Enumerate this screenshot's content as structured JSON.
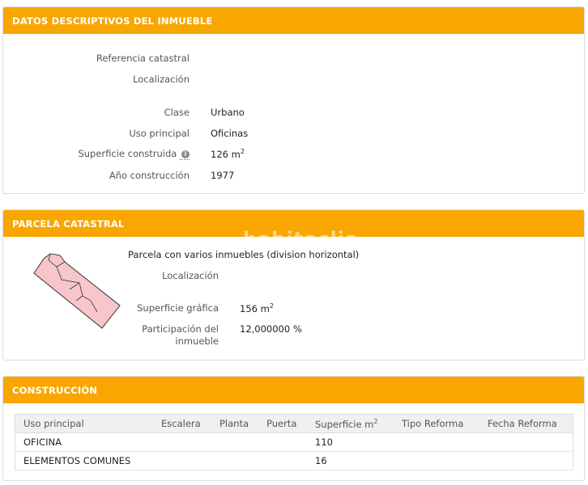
{
  "datos": {
    "title": "DATOS DESCRIPTIVOS DEL INMUEBLE",
    "rows": [
      {
        "label": "Referencia catastral",
        "value": ""
      },
      {
        "label": "Localización",
        "value": ""
      },
      {
        "label": "Clase",
        "value": "Urbano"
      },
      {
        "label": "Uso principal",
        "value": "Oficinas"
      },
      {
        "label": "Superficie construida",
        "value": "126 m",
        "sup": "2"
      },
      {
        "label": "Año construcción",
        "value": "1977"
      }
    ]
  },
  "parcela": {
    "title": "PARCELA CATASTRAL",
    "watermark": "habitaclia",
    "description": "Parcela con varios inmuebles (division horizontal)",
    "rows": [
      {
        "label": "Localización",
        "value": ""
      },
      {
        "label": "Superficie gráfica",
        "value": "156 m",
        "sup": "2"
      },
      {
        "label_line1": "Participación del",
        "label_line2": "inmueble",
        "value": "12,000000 %"
      }
    ]
  },
  "construccion": {
    "title": "CONSTRUCCIÓN",
    "headers": [
      "Uso principal",
      "Escalera",
      "Planta",
      "Puerta",
      "Superficie m",
      "Tipo Reforma",
      "Fecha Reforma"
    ],
    "header_sup": "2",
    "rows": [
      [
        "OFICINA",
        "",
        "",
        "",
        "110",
        "",
        ""
      ],
      [
        "ELEMENTOS COMUNES",
        "",
        "",
        "",
        "16",
        "",
        ""
      ]
    ]
  },
  "colors": {
    "header": "#f9a600",
    "parcel_fill": "#f7c6ca",
    "parcel_stroke": "#333333"
  }
}
